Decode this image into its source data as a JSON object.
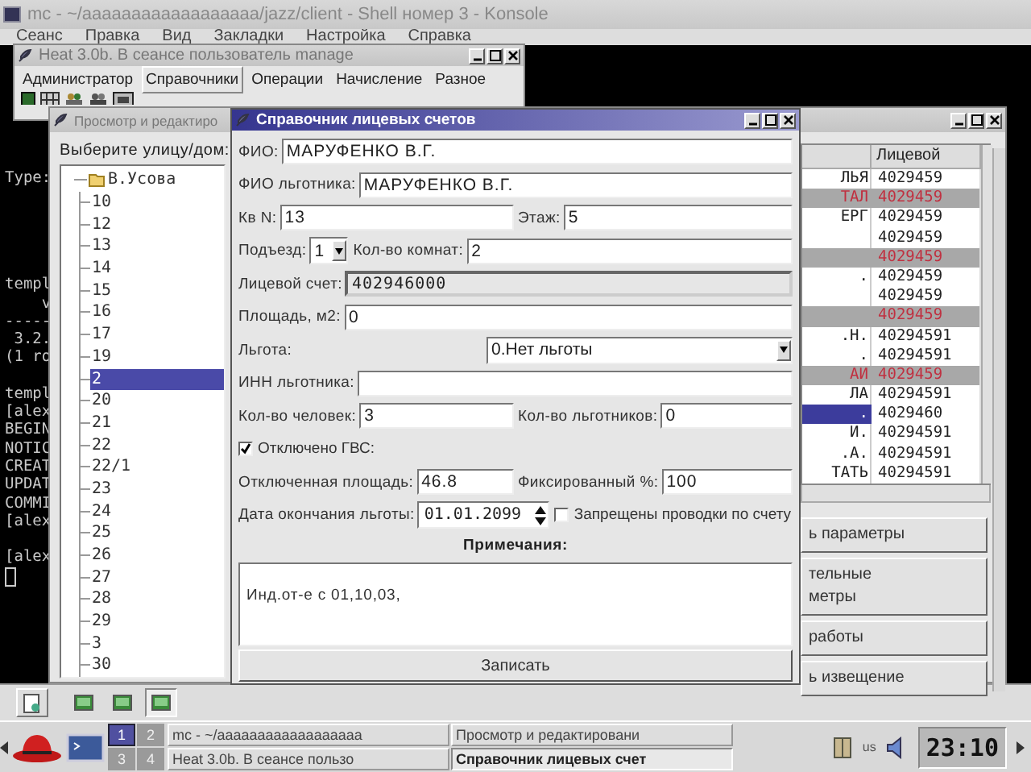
{
  "konsole": {
    "title": "mc - ~/aaaaaaaaaaaaaaaaaa/jazz/client - Shell номер 3 - Konsole",
    "menu": [
      "Сеанс",
      "Правка",
      "Вид",
      "Закладки",
      "Настройка",
      "Справка"
    ],
    "terminal_blocks": [
      [
        "Type:"
      ],
      [
        "templ",
        "    v",
        "-----",
        " 3.2.",
        "(1 ro"
      ],
      [
        "templ",
        "[alex",
        "BEGIN",
        "NOTIC",
        "CREAT",
        "UPDAT",
        "COMMI",
        "[alex"
      ],
      [
        "[alex"
      ]
    ],
    "sessions": [
      {
        "selected": false
      },
      {
        "selected": false
      },
      {
        "selected": true
      }
    ]
  },
  "heat_window": {
    "title": "Heat 3.0b. В сеансе пользователь manage",
    "menu": [
      {
        "label": "Администратор",
        "selected": false
      },
      {
        "label": "Справочники",
        "selected": true
      },
      {
        "label": "Операции",
        "selected": false
      },
      {
        "label": "Начисление",
        "selected": false
      },
      {
        "label": "Разное",
        "selected": false
      }
    ]
  },
  "browse_window": {
    "title": "Просмотр и редактиро",
    "tree": {
      "label": "Выберите улицу/дом:",
      "root": "В.Усова",
      "children": [
        {
          "text": "10",
          "selected": false
        },
        {
          "text": "12",
          "selected": false
        },
        {
          "text": "13",
          "selected": false
        },
        {
          "text": "14",
          "selected": false
        },
        {
          "text": "15",
          "selected": false
        },
        {
          "text": "16",
          "selected": false
        },
        {
          "text": "17",
          "selected": false
        },
        {
          "text": "19",
          "selected": false
        },
        {
          "text": "2",
          "selected": true
        },
        {
          "text": "20",
          "selected": false
        },
        {
          "text": "21",
          "selected": false
        },
        {
          "text": "22",
          "selected": false
        },
        {
          "text": "22/1",
          "selected": false
        },
        {
          "text": "23",
          "selected": false
        },
        {
          "text": "24",
          "selected": false
        },
        {
          "text": "25",
          "selected": false
        },
        {
          "text": "26",
          "selected": false
        },
        {
          "text": "27",
          "selected": false
        },
        {
          "text": "28",
          "selected": false
        },
        {
          "text": "29",
          "selected": false
        },
        {
          "text": "3",
          "selected": false
        },
        {
          "text": "30",
          "selected": false
        }
      ]
    },
    "table": {
      "columns": [
        "Лицевой"
      ],
      "rows": [
        {
          "name": "ЛЬЯ",
          "account": "4029459",
          "marked": false,
          "selected": false
        },
        {
          "name": "ТАЛ",
          "account": "4029459",
          "marked": true,
          "selected": false
        },
        {
          "name": "ЕРГ",
          "account": "4029459",
          "marked": false,
          "selected": false
        },
        {
          "account": "4029459",
          "marked": false,
          "selected": false
        },
        {
          "account": "4029459",
          "marked": true,
          "selected": false
        },
        {
          "name": ".",
          "account": "4029459",
          "marked": false,
          "selected": false
        },
        {
          "account": "4029459",
          "marked": false,
          "selected": false
        },
        {
          "account": "4029459",
          "marked": true,
          "selected": false
        },
        {
          "name": ".Н.",
          "account": "40294591",
          "marked": false,
          "selected": false
        },
        {
          "name": ".",
          "account": "40294591",
          "marked": false,
          "selected": false
        },
        {
          "name": "АИ",
          "account": "4029459",
          "marked": true,
          "selected": false
        },
        {
          "name": "ЛА",
          "account": "40294591",
          "marked": false,
          "selected": false
        },
        {
          "name": ".",
          "account": "4029460",
          "marked": false,
          "selected": true
        },
        {
          "name": "И.",
          "account": "40294591",
          "marked": false,
          "selected": false
        },
        {
          "name": ".А.",
          "account": "40294591",
          "marked": false,
          "selected": false
        },
        {
          "name": "ТАТЬ",
          "account": "40294591",
          "marked": false,
          "selected": false
        }
      ]
    },
    "buttons": [
      "ь параметры",
      "тельные\nметры",
      "работы",
      "ь извещение"
    ]
  },
  "account_window": {
    "title": "Справочник лицевых счетов",
    "rows": [
      [
        {
          "kind": "text",
          "label": "ФИО:",
          "value": "МАРУФЕНКО В.Г."
        }
      ],
      [
        {
          "kind": "text",
          "label": "ФИО льготника:",
          "value": "МАРУФЕНКО В.Г."
        }
      ],
      [
        {
          "kind": "text",
          "label": "Кв N:",
          "value": "13"
        },
        {
          "kind": "text",
          "label": "Этаж:",
          "value": "5"
        }
      ],
      [
        {
          "kind": "combo",
          "label": "Подъезд:",
          "value": "1"
        },
        {
          "kind": "text",
          "label": "Кол-во комнат:",
          "value": "2"
        }
      ],
      [
        {
          "kind": "readonly",
          "label": "Лицевой счет:",
          "value": "402946000"
        }
      ],
      [
        {
          "kind": "text",
          "label": "Площадь, м2:",
          "value": "0"
        }
      ],
      [
        {
          "kind": "combo",
          "label": "Льгота:",
          "value": "0.Нет льготы"
        }
      ],
      [
        {
          "kind": "text",
          "label": "ИНН льготника:"
        }
      ],
      [
        {
          "kind": "text",
          "label": "Кол-во человек:",
          "value": "3"
        },
        {
          "kind": "text",
          "label": "Кол-во льготников:",
          "value": "0"
        }
      ],
      [
        {
          "kind": "checkbox",
          "label": "Отключено ГВС:",
          "checked": true
        }
      ],
      [
        {
          "kind": "text",
          "label": "Отключенная площадь:",
          "value": "46.8"
        },
        {
          "kind": "text",
          "label": "Фиксированный %:",
          "value": "100"
        }
      ],
      [
        {
          "kind": "date",
          "label": "Дата окончания льготы:",
          "value": "01.01.2099"
        },
        {
          "kind": "checkbox",
          "label": "Запрещены проводки по счету",
          "checked": false
        }
      ]
    ],
    "notes_title": "Примечания:",
    "notes": "Инд.от-е с 01,10,03,",
    "save_button": "Записать"
  },
  "taskbar": {
    "desktops": [
      {
        "label": "1",
        "selected": true
      },
      {
        "label": "2",
        "selected": false
      },
      {
        "label": "3",
        "selected": false
      },
      {
        "label": "4",
        "selected": false
      }
    ],
    "tasks": [
      {
        "label": "mc - ~/aaaaaaaaaaaaaaaaaa",
        "selected": false
      },
      {
        "label": "Просмотр и редактировани",
        "selected": false
      },
      {
        "label": "Heat 3.0b. В сеансе пользо",
        "selected": false
      },
      {
        "label": "Справочник лицевых счет",
        "selected": true
      }
    ],
    "keyboard": "us",
    "clock": "23:10"
  }
}
